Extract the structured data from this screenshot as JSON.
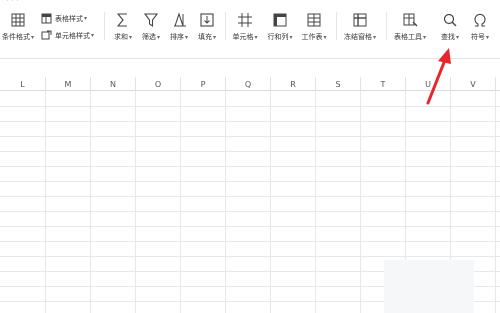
{
  "ribbon": {
    "conditional_format": "条件格式",
    "table_style": "表格样式",
    "cell_style": "单元格样式",
    "sum": "求和",
    "filter": "筛选",
    "sort": "排序",
    "fill": "填充",
    "cell": "单元格",
    "row_col": "行和列",
    "worksheet": "工作表",
    "freeze": "冻结窗格",
    "table_tools": "表格工具",
    "find": "查找",
    "symbol": "符号",
    "caret": "▾"
  },
  "columns": [
    "L",
    "M",
    "N",
    "O",
    "P",
    "Q",
    "R",
    "S",
    "T",
    "U",
    "V"
  ],
  "annotation": {
    "arrow_color": "#e8262a"
  }
}
